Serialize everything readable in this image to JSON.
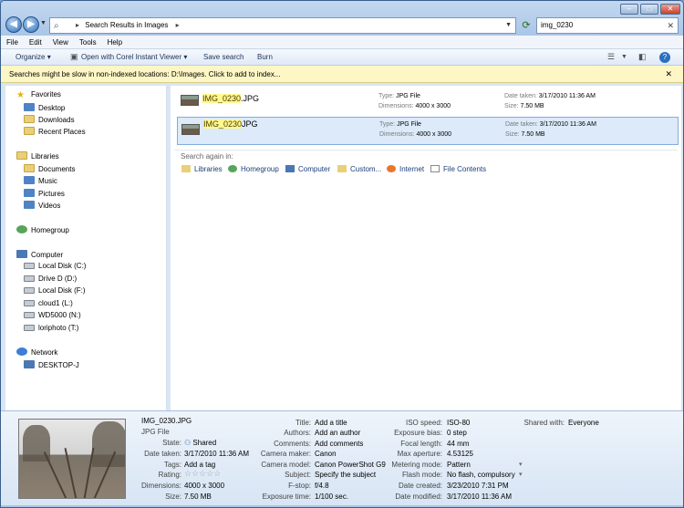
{
  "window": {
    "address": "Search Results in Images",
    "search_value": "img_0230",
    "controls": {
      "minimize": "–",
      "maximize": "□",
      "close": "✕"
    }
  },
  "menu": [
    "File",
    "Edit",
    "View",
    "Tools",
    "Help"
  ],
  "toolbar": {
    "organize": "Organize",
    "open_with": "Open with Corel Instant Viewer",
    "save_search": "Save search",
    "burn": "Burn"
  },
  "infobar": {
    "text": "Searches might be slow in non-indexed locations: D:\\Images. Click to add to index..."
  },
  "nav": {
    "favorites": {
      "label": "Favorites",
      "items": [
        "Desktop",
        "Downloads",
        "Recent Places"
      ]
    },
    "libraries": {
      "label": "Libraries",
      "items": [
        "Documents",
        "Music",
        "Pictures",
        "Videos"
      ]
    },
    "homegroup": "Homegroup",
    "computer": {
      "label": "Computer",
      "items": [
        "Local Disk (C:)",
        "Drive D (D:)",
        "Local Disk (F:)",
        "cloud1 (L:)",
        "WD5000 (N:)",
        "loriphoto (T:)"
      ]
    },
    "network": {
      "label": "Network",
      "items": [
        "DESKTOP-J"
      ]
    }
  },
  "results": [
    {
      "name_hl": "IMG_0230",
      "name_ext": ".JPG",
      "type_label": "Type:",
      "type": "JPG File",
      "dim_label": "Dimensions:",
      "dim": "4000 x 3000",
      "date_label": "Date taken:",
      "date": "3/17/2010 11:36 AM",
      "size_label": "Size:",
      "size": "7.50 MB",
      "selected": false
    },
    {
      "name_hl": "IMG_0230",
      "name_ext": "JPG",
      "type_label": "Type:",
      "type": "JPG File",
      "dim_label": "Dimensions:",
      "dim": "4000 x 3000",
      "date_label": "Date taken:",
      "date": "3/17/2010 11:36 AM",
      "size_label": "Size:",
      "size": "7.50 MB",
      "selected": true
    }
  ],
  "search_again": {
    "label": "Search again in:",
    "items": [
      "Libraries",
      "Homegroup",
      "Computer",
      "Custom...",
      "Internet",
      "File Contents"
    ]
  },
  "details": {
    "filename": "IMG_0230.JPG",
    "filetype": "JPG File",
    "col1": [
      {
        "label": "State:",
        "value": "Shared"
      },
      {
        "label": "Date taken:",
        "value": "3/17/2010 11:36 AM"
      },
      {
        "label": "Tags:",
        "value": "Add a tag"
      },
      {
        "label": "Rating:",
        "value": ""
      },
      {
        "label": "Dimensions:",
        "value": "4000 x 3000"
      },
      {
        "label": "Size:",
        "value": "7.50 MB"
      }
    ],
    "col2": [
      {
        "label": "Title:",
        "value": "Add a title"
      },
      {
        "label": "Authors:",
        "value": "Add an author"
      },
      {
        "label": "Comments:",
        "value": "Add comments"
      },
      {
        "label": "Camera maker:",
        "value": "Canon"
      },
      {
        "label": "Camera model:",
        "value": "Canon PowerShot G9"
      },
      {
        "label": "Subject:",
        "value": "Specify the subject"
      },
      {
        "label": "F-stop:",
        "value": "f/4.8"
      },
      {
        "label": "Exposure time:",
        "value": "1/100 sec."
      }
    ],
    "col3": [
      {
        "label": "ISO speed:",
        "value": "ISO-80"
      },
      {
        "label": "Exposure bias:",
        "value": "0 step"
      },
      {
        "label": "Focal length:",
        "value": "44 mm"
      },
      {
        "label": "Max aperture:",
        "value": "4.53125"
      },
      {
        "label": "Metering mode:",
        "value": "Pattern"
      },
      {
        "label": "Flash mode:",
        "value": "No flash, compulsory"
      },
      {
        "label": "Date created:",
        "value": "3/23/2010 7:31 PM"
      },
      {
        "label": "Date modified:",
        "value": "3/17/2010 11:36 AM"
      }
    ],
    "shared_with": {
      "label": "Shared with:",
      "value": "Everyone"
    },
    "rating_stars": "☆☆☆☆☆"
  }
}
